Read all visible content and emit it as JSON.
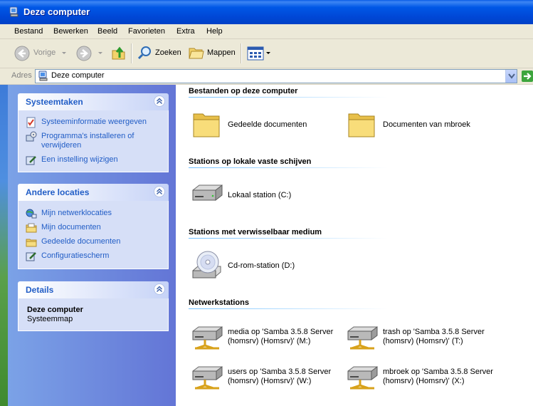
{
  "window": {
    "title": "Deze computer",
    "icon": "my-computer-icon"
  },
  "menu": [
    "Bestand",
    "Bewerken",
    "Beeld",
    "Favorieten",
    "Extra",
    "Help"
  ],
  "toolbar": {
    "back_label": "Vorige",
    "search_label": "Zoeken",
    "folders_label": "Mappen"
  },
  "address": {
    "label": "Adres",
    "value": "Deze computer"
  },
  "left": {
    "system_tasks": {
      "title": "Systeemtaken",
      "items": [
        "Systeeminformatie weergeven",
        "Programma's installeren of verwijderen",
        "Een instelling wijzigen"
      ]
    },
    "other_places": {
      "title": "Andere locaties",
      "items": [
        "Mijn netwerklocaties",
        "Mijn documenten",
        "Gedeelde documenten",
        "Configuratiescherm"
      ]
    },
    "details": {
      "title": "Details",
      "name": "Deze computer",
      "type": "Systeemmap"
    }
  },
  "groups": [
    {
      "title": "Bestanden op deze computer",
      "items": [
        "Gedeelde documenten",
        "Documenten van mbroek"
      ]
    },
    {
      "title": "Stations op lokale vaste schijven",
      "items": [
        "Lokaal station (C:)"
      ]
    },
    {
      "title": "Stations met verwisselbaar medium",
      "items": [
        "Cd-rom-station (D:)"
      ]
    },
    {
      "title": "Netwerkstations",
      "items": [
        {
          "line1": "media op 'Samba 3.5.8 Server",
          "line2": "(homsrv) (Homsrv)' (M:)"
        },
        {
          "line1": "trash op 'Samba 3.5.8 Server",
          "line2": "(homsrv) (Homsrv)' (T:)"
        },
        {
          "line1": "users op 'Samba 3.5.8 Server",
          "line2": "(homsrv) (Homsrv)' (W:)"
        },
        {
          "line1": "mbroek op 'Samba 3.5.8 Server",
          "line2": "(homsrv) (Homsrv)' (X:)"
        }
      ]
    }
  ]
}
